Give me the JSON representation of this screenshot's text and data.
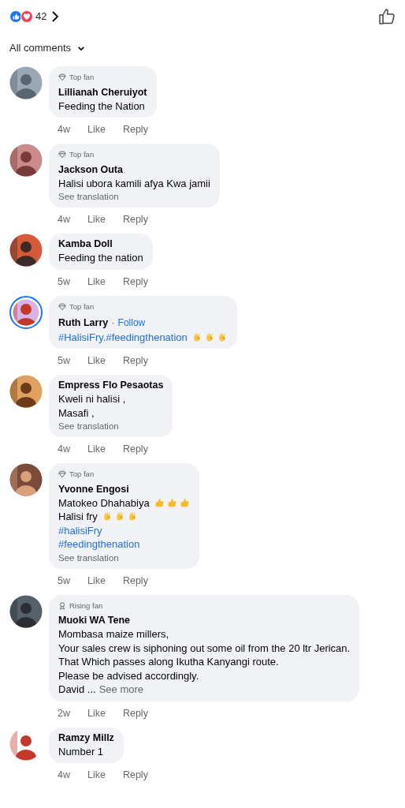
{
  "reactions": {
    "count": "42"
  },
  "filter": {
    "label": "All comments"
  },
  "comments": [
    {
      "badge": {
        "kind": "top",
        "label": "Top fan"
      },
      "name": "Lillianah Cheruiyot",
      "story_ring": false,
      "lines": [
        {
          "kind": "plain",
          "text": "Feeding the Nation"
        }
      ],
      "time": "4w",
      "like": "Like",
      "reply": "Reply"
    },
    {
      "badge": {
        "kind": "top",
        "label": "Top fan"
      },
      "name": "Jackson Outa",
      "story_ring": false,
      "lines": [
        {
          "kind": "plain",
          "text": "Halisi ubora kamili afya Kwa jamii"
        }
      ],
      "see_translation": "See translation",
      "time": "4w",
      "like": "Like",
      "reply": "Reply"
    },
    {
      "name": "Kamba Doll",
      "story_ring": false,
      "lines": [
        {
          "kind": "plain",
          "text": "Feeding the nation"
        }
      ],
      "time": "5w",
      "like": "Like",
      "reply": "Reply"
    },
    {
      "badge": {
        "kind": "top",
        "label": "Top fan"
      },
      "name": "Ruth Larry",
      "follow": {
        "separator": "·",
        "label": "Follow"
      },
      "story_ring": true,
      "lines": [
        {
          "kind": "hashtag",
          "text": "#HalisiFry.#feedingthenation",
          "emojis": [
            {
              "kind": "ok"
            },
            {
              "kind": "ok"
            },
            {
              "kind": "ok"
            }
          ]
        }
      ],
      "time": "5w",
      "like": "Like",
      "reply": "Reply"
    },
    {
      "name": "Empress Flo Pesaotas",
      "story_ring": false,
      "lines": [
        {
          "kind": "plain",
          "text": "Kweli ni halisi ,"
        },
        {
          "kind": "plain",
          "text": "Masafi ,"
        }
      ],
      "see_translation": "See translation",
      "time": "4w",
      "like": "Like",
      "reply": "Reply"
    },
    {
      "badge": {
        "kind": "top",
        "label": "Top fan"
      },
      "name": "Yvonne Engosi",
      "story_ring": false,
      "lines": [
        {
          "kind": "plain",
          "text": "Matokeo Dhahabiya",
          "emojis": [
            {
              "kind": "thumb"
            },
            {
              "kind": "thumb"
            },
            {
              "kind": "thumb"
            }
          ]
        },
        {
          "kind": "plain",
          "text": "Halisi fry",
          "emojis": [
            {
              "kind": "ok"
            },
            {
              "kind": "ok"
            },
            {
              "kind": "ok"
            }
          ]
        },
        {
          "kind": "hashtag",
          "text": "#halisiFry"
        },
        {
          "kind": "hashtag",
          "text": "#feedingthenation"
        }
      ],
      "see_translation": "See translation",
      "time": "5w",
      "like": "Like",
      "reply": "Reply"
    },
    {
      "badge": {
        "kind": "rising",
        "label": "Rising fan"
      },
      "name": "Muoki WA Tene",
      "story_ring": false,
      "lines": [
        {
          "kind": "plain",
          "text": "Mombasa maize millers,"
        },
        {
          "kind": "plain",
          "text": "Your sales crew is siphoning out some oil from the 20 ltr Jerican."
        },
        {
          "kind": "plain",
          "text": "That Which passes along Ikutha Kanyangi route."
        },
        {
          "kind": "plain",
          "text": "Please be advised accordingly."
        },
        {
          "kind": "plain",
          "text": "David ...",
          "see_more": "See more"
        }
      ],
      "time": "2w",
      "like": "Like",
      "reply": "Reply"
    },
    {
      "name": "Ramzy Millz",
      "story_ring": false,
      "lines": [
        {
          "kind": "plain",
          "text": "Number 1"
        }
      ],
      "time": "4w",
      "like": "Like",
      "reply": "Reply"
    }
  ]
}
